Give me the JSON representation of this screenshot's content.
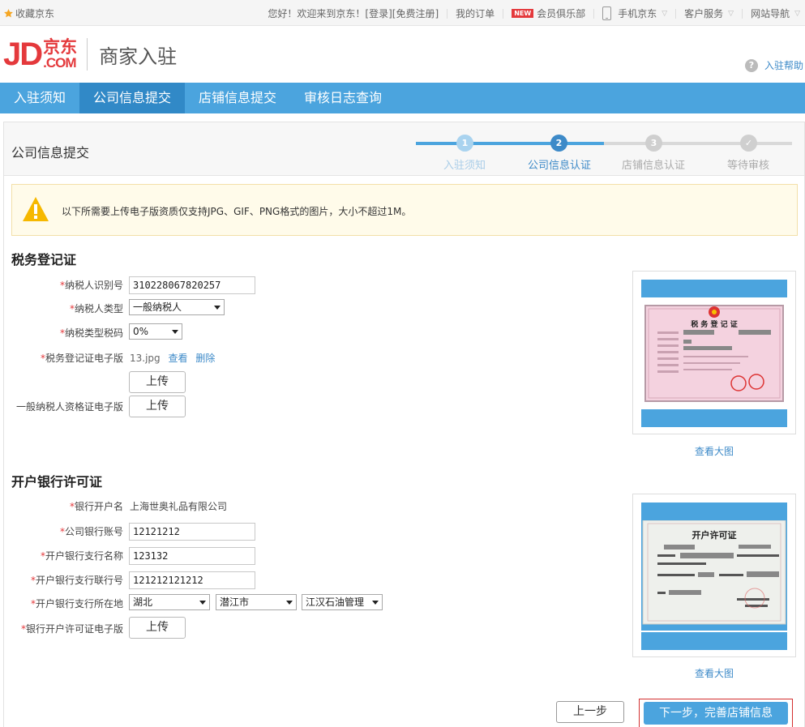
{
  "topbar": {
    "favorite": "收藏京东",
    "welcome": "您好！欢迎来到京东！",
    "login": "[登录]",
    "register": "[免费注册]",
    "orders": "我的订单",
    "new_badge": "NEW",
    "club": "会员俱乐部",
    "mobile": "手机京东",
    "service": "客户服务",
    "sitenav": "网站导航"
  },
  "header": {
    "logo_jd": "JD",
    "logo_cn": "京东",
    "logo_com": ".COM",
    "title": "商家入驻",
    "help": "入驻帮助"
  },
  "nav": {
    "tabs": [
      {
        "label": "入驻须知"
      },
      {
        "label": "公司信息提交"
      },
      {
        "label": "店铺信息提交"
      },
      {
        "label": "审核日志查询"
      }
    ]
  },
  "panel": {
    "title": "公司信息提交",
    "steps": [
      {
        "num": "1",
        "label": "入驻须知"
      },
      {
        "num": "2",
        "label": "公司信息认证"
      },
      {
        "num": "3",
        "label": "店铺信息认证"
      },
      {
        "num": "✓",
        "label": "等待审核"
      }
    ],
    "notice": "以下所需要上传电子版资质仅支持JPG、GIF、PNG格式的图片，大小不超过1M。"
  },
  "tax": {
    "title": "税务登记证",
    "taxpayer_id_label": "纳税人识别号",
    "taxpayer_id_value": "310228067820257",
    "taxpayer_type_label": "纳税人类型",
    "taxpayer_type_value": "一般纳税人",
    "tax_rate_label": "纳税类型税码",
    "tax_rate_value": "0%",
    "cert_label": "税务登记证电子版",
    "cert_file": "13.jpg",
    "view": "查看",
    "delete": "删除",
    "upload": "上传",
    "general_cert_label": "一般纳税人资格证电子版",
    "upload2": "上传",
    "preview_link": "查看大图",
    "preview_doc_title": "税 务 登 记 证"
  },
  "bank": {
    "title": "开户银行许可证",
    "account_name_label": "银行开户名",
    "account_name_value": "上海世奥礼品有限公司",
    "account_no_label": "公司银行账号",
    "account_no_value": "12121212",
    "branch_name_label": "开户银行支行名称",
    "branch_name_value": "123132",
    "branch_code_label": "开户银行支行联行号",
    "branch_code_value": "121212121212",
    "location_label": "开户银行支行所在地",
    "province": "湖北",
    "city": "潜江市",
    "district": "江汉石油管理",
    "license_label": "银行开户许可证电子版",
    "upload": "上传",
    "preview_link": "查看大图",
    "preview_doc_title": "开户许可证"
  },
  "actions": {
    "prev": "上一步",
    "next": "下一步，完善店铺信息"
  },
  "colors": {
    "brand_red": "#e4393c",
    "nav_blue": "#4ba4de",
    "nav_active": "#3189c7",
    "link_blue": "#3d8ac8"
  }
}
